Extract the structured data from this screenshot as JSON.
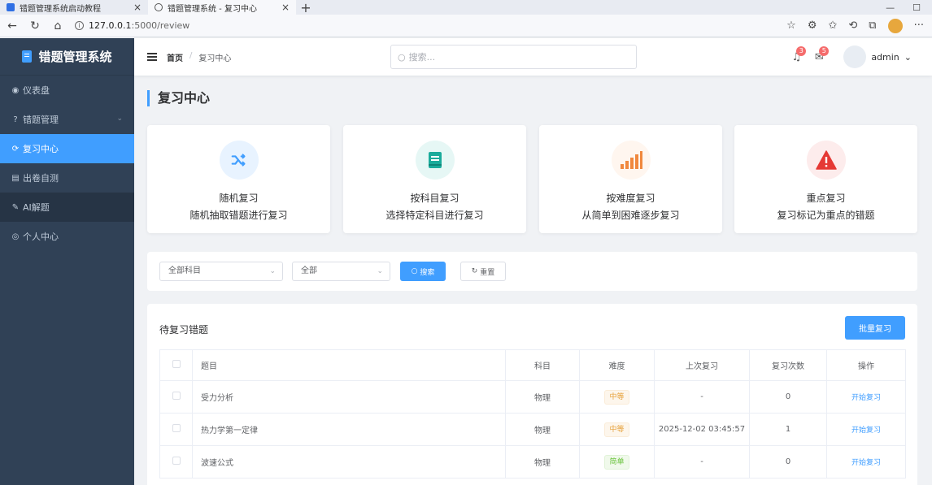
{
  "browser": {
    "tabs": [
      {
        "title": "错题管理系统启动教程",
        "close": "×"
      },
      {
        "title": "错题管理系统 - 复习中心",
        "close": "×"
      }
    ],
    "new_tab": "+",
    "window_controls": [
      "—",
      "☐",
      "✕"
    ],
    "nav": [
      "←",
      "↻",
      "⌂"
    ],
    "url_host": "127.0.0.1",
    "url_path": ":5000/review",
    "right_icons": [
      "☆",
      "⚙",
      "✩",
      "⟲",
      "⧉"
    ],
    "more": "···"
  },
  "sidebar": {
    "brand": "错题管理系统",
    "items": [
      {
        "label": "仪表盘",
        "icon": "dashboard-icon",
        "glyph": "◉"
      },
      {
        "label": "错题管理",
        "icon": "question-circle-icon",
        "glyph": "?",
        "caret": "⌄"
      },
      {
        "label": "复习中心",
        "icon": "refresh-icon",
        "glyph": "⟳"
      },
      {
        "label": "出卷自测",
        "icon": "file-icon",
        "glyph": "▤"
      },
      {
        "label": "AI解题",
        "icon": "edit-icon",
        "glyph": "✎"
      },
      {
        "label": "个人中心",
        "icon": "user-icon",
        "glyph": "◎"
      }
    ]
  },
  "header": {
    "breadcrumb": {
      "home": "首页",
      "sep": "/",
      "current": "复习中心"
    },
    "search_placeholder": "搜索...",
    "search_icon": "○",
    "notifications": {
      "glyph": "♫",
      "count": "3"
    },
    "messages": {
      "glyph": "✉",
      "count": "5"
    },
    "username": "admin",
    "user_caret": "⌄"
  },
  "page": {
    "title": "复习中心",
    "cards": [
      {
        "name": "随机复习",
        "desc": "随机抽取错题进行复习",
        "icon": "shuffle-icon",
        "bg": "#e8f3ff",
        "fg": "#409eff"
      },
      {
        "name": "按科目复习",
        "desc": "选择特定科目进行复习",
        "icon": "book-icon",
        "bg": "#e6f7f5",
        "fg": "#1aab9b"
      },
      {
        "name": "按难度复习",
        "desc": "从简单到困难逐步复习",
        "icon": "signal-bars-icon",
        "bg": "#fff6ef",
        "fg": "#f0883e"
      },
      {
        "name": "重点复习",
        "desc": "复习标记为重点的错题",
        "icon": "warning-icon",
        "bg": "#fdecec",
        "fg": "#e53935"
      }
    ],
    "filter": {
      "subject_value": "全部科目",
      "difficulty_value": "全部",
      "chevron": "⌄",
      "search_label": "搜索",
      "search_glyph": "○",
      "reset_label": "重置",
      "reset_glyph": "↻"
    },
    "table": {
      "title": "待复习错题",
      "batch_label": "批量复习",
      "headers": [
        "题目",
        "科目",
        "难度",
        "上次复习",
        "复习次数",
        "操作"
      ],
      "rows": [
        {
          "title": "受力分析",
          "subject": "物理",
          "difficulty": "中等",
          "level": "mid",
          "last": "-",
          "count": "0",
          "action": "开始复习"
        },
        {
          "title": "热力学第一定律",
          "subject": "物理",
          "difficulty": "中等",
          "level": "mid",
          "last": "2025-12-02 03:45:57",
          "count": "1",
          "action": "开始复习"
        },
        {
          "title": "波速公式",
          "subject": "物理",
          "difficulty": "简单",
          "level": "easy",
          "last": "-",
          "count": "0",
          "action": "开始复习"
        }
      ]
    }
  }
}
